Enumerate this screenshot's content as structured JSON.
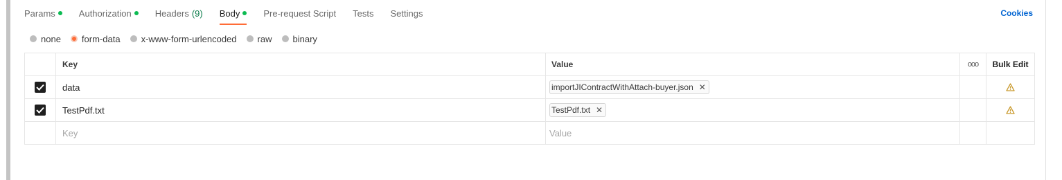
{
  "tabs": [
    {
      "label": "Params",
      "dot": true,
      "count": ""
    },
    {
      "label": "Authorization",
      "dot": true,
      "count": ""
    },
    {
      "label": "Headers",
      "dot": false,
      "count": "(9)"
    },
    {
      "label": "Body",
      "dot": true,
      "count": "",
      "active": true
    },
    {
      "label": "Pre-request Script",
      "dot": false,
      "count": ""
    },
    {
      "label": "Tests",
      "dot": false,
      "count": ""
    },
    {
      "label": "Settings",
      "dot": false,
      "count": ""
    }
  ],
  "cookies_label": "Cookies",
  "body_types": {
    "options": [
      "none",
      "form-data",
      "x-www-form-urlencoded",
      "raw",
      "binary"
    ],
    "selected": "form-data"
  },
  "table": {
    "headers": {
      "key": "Key",
      "value": "Value",
      "more": "ooo",
      "bulk_edit": "Bulk Edit"
    },
    "rows": [
      {
        "checked": true,
        "key": "data",
        "file": "importJIContractWithAttach-buyer.json",
        "warning": true
      },
      {
        "checked": true,
        "key": "TestPdf.txt",
        "file": "TestPdf.txt",
        "warning": true
      }
    ],
    "new_row": {
      "key_placeholder": "Key",
      "value_placeholder": "Value"
    }
  },
  "colors": {
    "accent": "#ff6c37",
    "link": "#0265d2",
    "status_dot": "#0cbb52",
    "warning": "#c99a2e"
  }
}
